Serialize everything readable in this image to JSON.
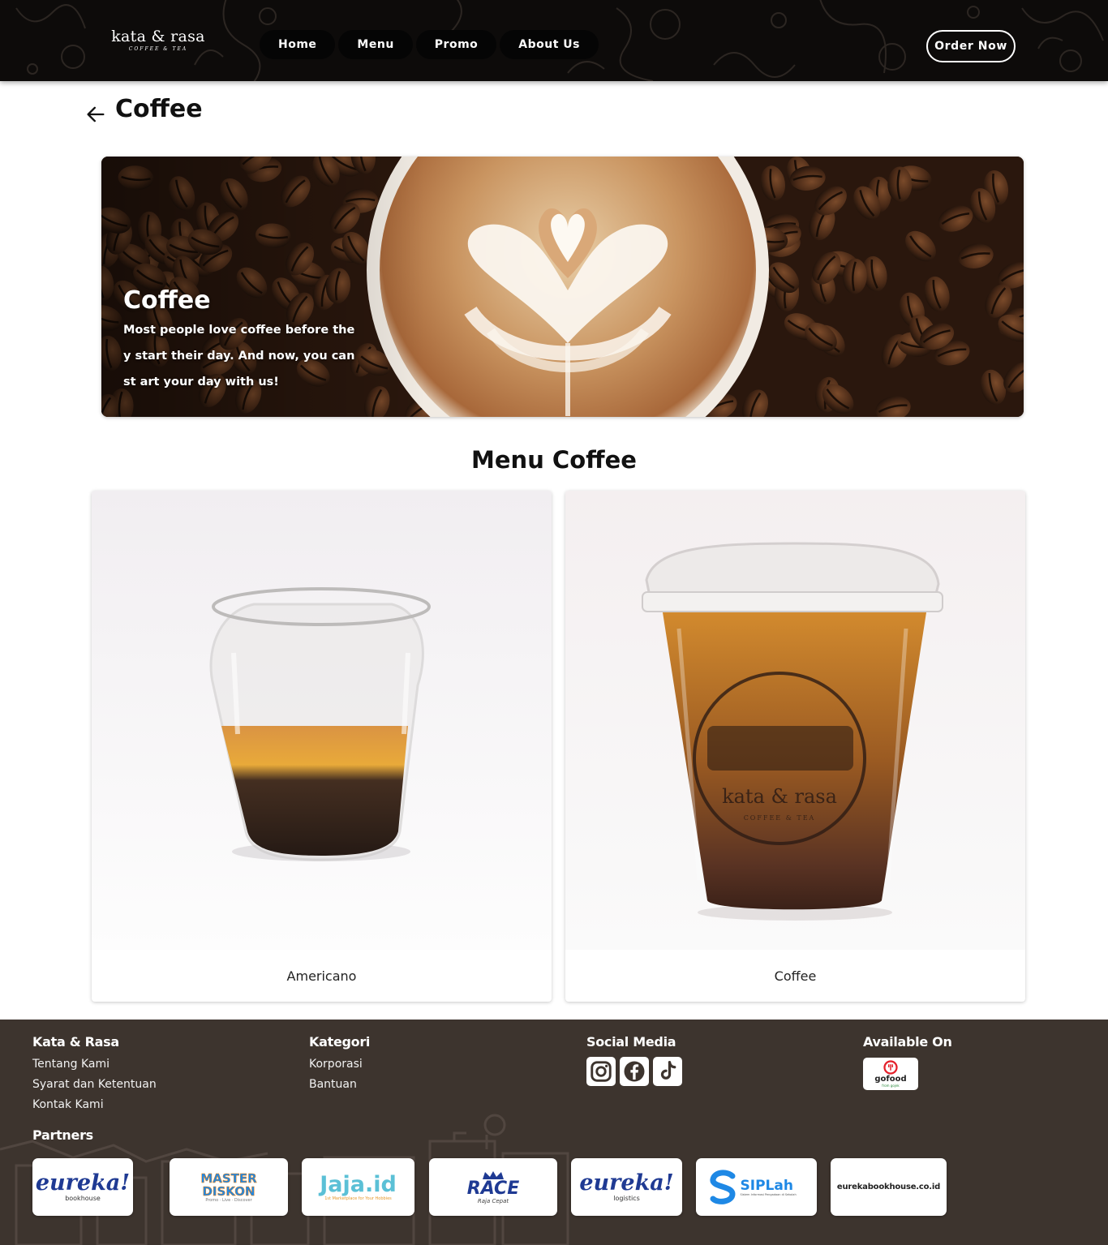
{
  "header": {
    "logo": {
      "wordmark": "kata & rasa",
      "tagline": "COFFEE & TEA"
    },
    "nav": [
      "Home",
      "Menu",
      "Promo",
      "About Us"
    ],
    "order_button": "Order Now"
  },
  "page": {
    "title": "Coffee",
    "back_icon": "arrow-left-icon"
  },
  "banner": {
    "title": "Coffee",
    "description": "Most people love coffee before they start their day. And now, you can st art your day with us!"
  },
  "menu": {
    "section_title": "Menu Coffee",
    "items": [
      {
        "name": "Americano"
      },
      {
        "name": "Coffee"
      }
    ]
  },
  "footer": {
    "col1": {
      "heading": "Kata & Rasa",
      "links": [
        "Tentang Kami",
        "Syarat dan Ketentuan",
        "Kontak Kami"
      ]
    },
    "col2": {
      "heading": "Kategori",
      "links": [
        "Korporasi",
        "Bantuan"
      ]
    },
    "col3": {
      "heading": "Social Media",
      "icons": [
        "instagram-icon",
        "facebook-icon",
        "tiktok-icon"
      ]
    },
    "col4": {
      "heading": "Available On",
      "badge": {
        "name": "gofood",
        "sub": "from gojek"
      }
    },
    "partners_heading": "Partners",
    "partners": [
      {
        "name": "eureka!",
        "sub": "bookhouse"
      },
      {
        "name": "MASTER DISKON",
        "sub": "Promo · Live · Discover"
      },
      {
        "name": "Jaja.id",
        "sub": "1st Marketplace for Your Hobbies"
      },
      {
        "name": "RACE",
        "sub": "Raja Cepat"
      },
      {
        "name": "eureka!",
        "sub": "logistics"
      },
      {
        "name": "SIPLah",
        "sub": "Sistem Informasi Pengadaan di Sekolah"
      },
      {
        "name": "eurekabookhouse.co.id",
        "sub": ""
      }
    ]
  },
  "colors": {
    "header_bg": "#0d0b0a",
    "footer_bg": "#3d342e",
    "text": "#111111"
  }
}
